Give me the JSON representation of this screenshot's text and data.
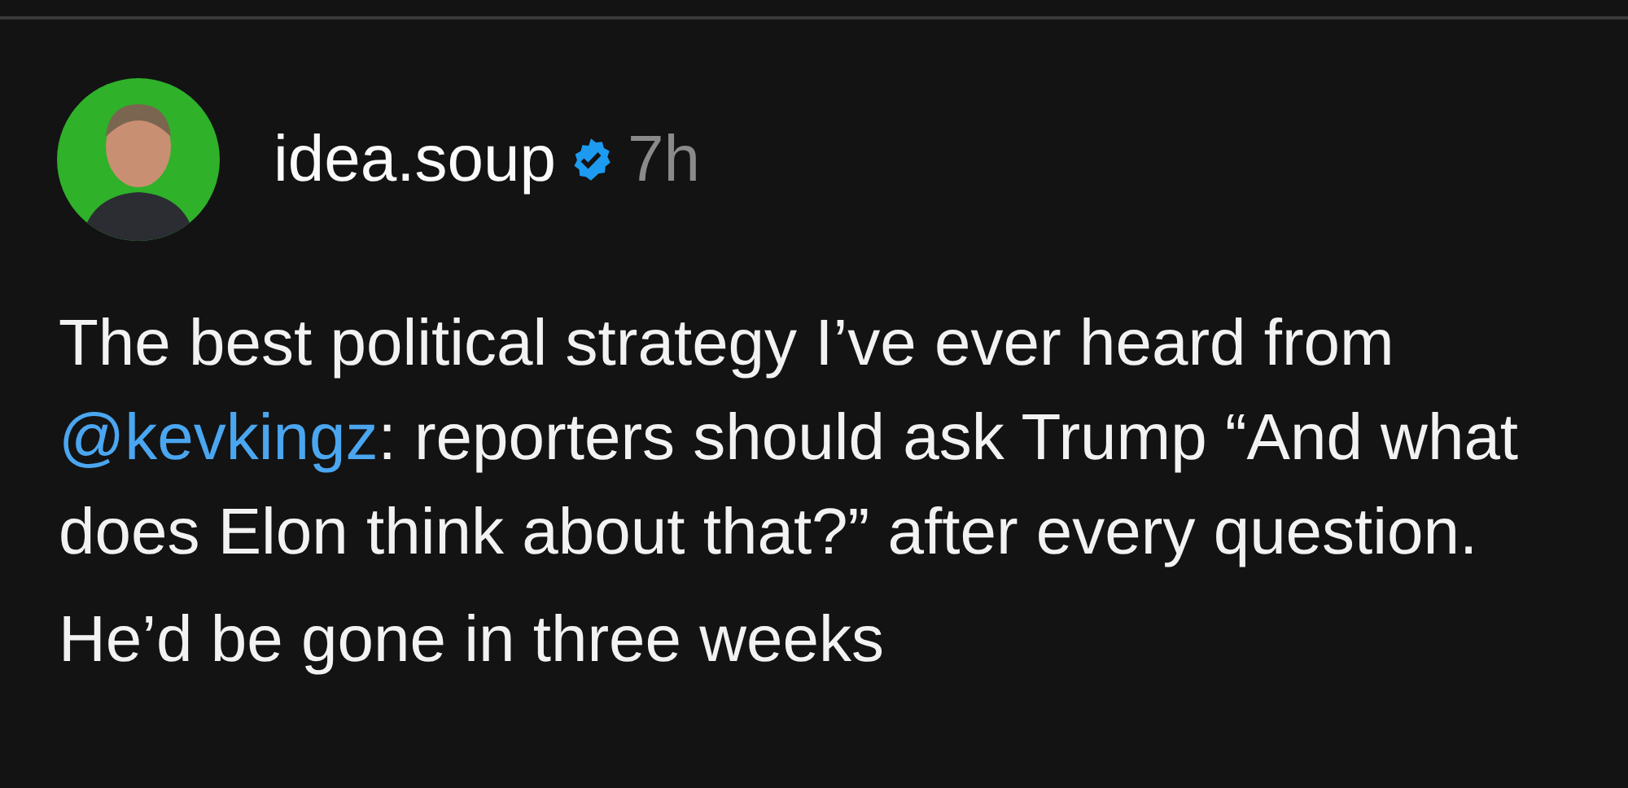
{
  "post": {
    "author": "idea.soup",
    "verified": true,
    "time": "7h",
    "body": [
      {
        "before": "The best political strategy I’ve ever heard from ",
        "mention": "@kevkingz",
        "after": ": reporters should ask Trump “And what does Elon think about that?” after every question."
      },
      {
        "before": "He’d be gone in three weeks"
      }
    ]
  }
}
